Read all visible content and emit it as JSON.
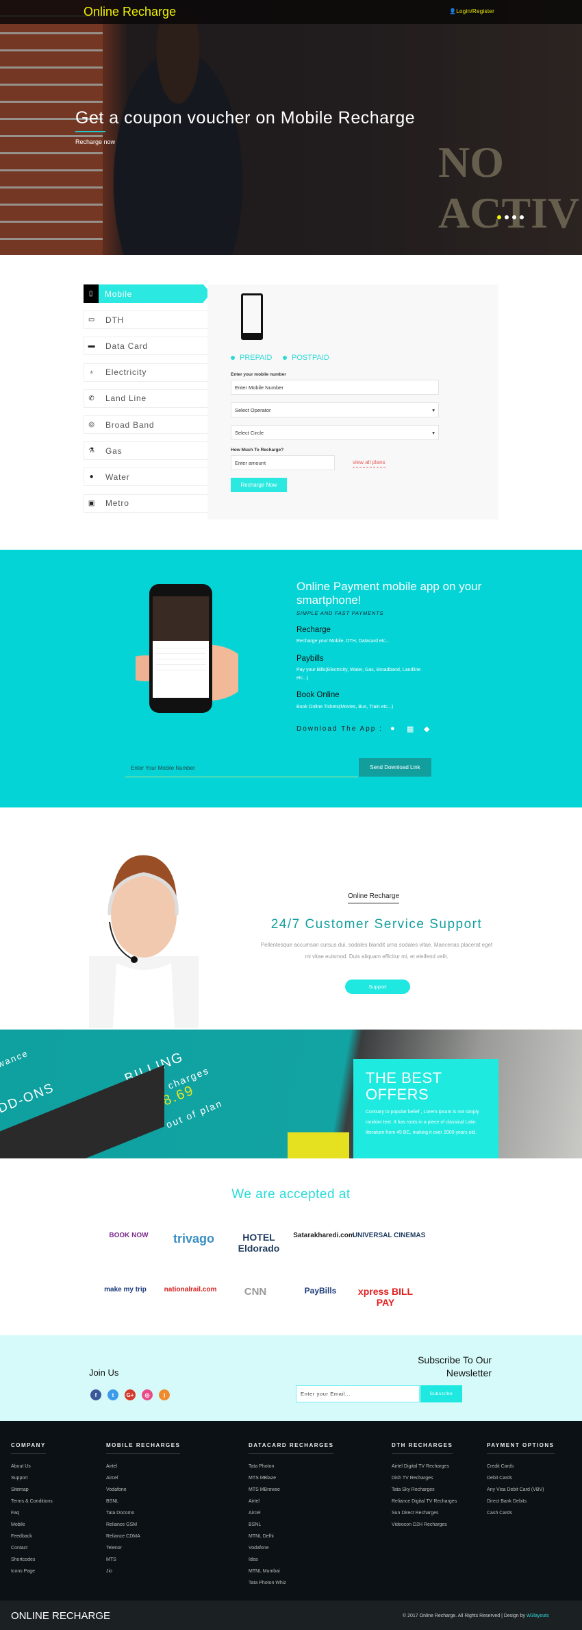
{
  "header": {
    "logo": "Online Recharge",
    "login": "Login/Register"
  },
  "hero": {
    "title": "Get a coupon voucher on Mobile Recharge",
    "subtitle": "Recharge now",
    "background_sign": "NO ACTIV",
    "slides": 4,
    "active_slide": 1
  },
  "recharge": {
    "tabs": [
      {
        "label": "Mobile",
        "icon": "mobile-icon",
        "active": true
      },
      {
        "label": "DTH",
        "icon": "tv-icon"
      },
      {
        "label": "Data Card",
        "icon": "credit-card-icon"
      },
      {
        "label": "Electricity",
        "icon": "bulb-icon"
      },
      {
        "label": "Land Line",
        "icon": "phone-icon"
      },
      {
        "label": "Broad Band",
        "icon": "globe-icon"
      },
      {
        "label": "Gas",
        "icon": "flask-icon"
      },
      {
        "label": "Water",
        "icon": "drop-icon"
      },
      {
        "label": "Metro",
        "icon": "train-icon"
      }
    ],
    "plan_types": [
      "PREPAID",
      "POSTPAID"
    ],
    "mobile_label": "Enter your mobile number",
    "mobile_placeholder": "Enter Mobile Number",
    "operator": "Select Operator",
    "circle": "Select Circle",
    "amount_label": "How Much To Recharge?",
    "amount_placeholder": "Enter amount",
    "view_plans": "view all plans",
    "submit": "Recharge Now"
  },
  "app": {
    "title": "Online Payment mobile app on your smartphone!",
    "tagline": "SIMPLE AND FAST PAYMENTS",
    "features": [
      {
        "title": "Recharge",
        "desc": "Recharge your Mobile, DTH, Datacard etc..."
      },
      {
        "title": "Paybills",
        "desc": "Pay your Bills(Electricity, Water, Gas, Broadband, Landline etc...)"
      },
      {
        "title": "Book Online",
        "desc": "Book Online Tickets(Movies, Bus, Train etc...)"
      }
    ],
    "download_label": "Download The App :",
    "platforms": [
      "apple-icon",
      "windows-icon",
      "android-icon"
    ],
    "input_placeholder": "Enter Your Mobile Number",
    "send_button": "Send Download Link"
  },
  "support": {
    "brand": "Online Recharge",
    "title": "24/7 Customer Service Support",
    "text": "Pellentesque accumsan cursus dui, sodales blandit urna sodales vitae. Maecenas placerat eget mi vitae euismod. Duis aliquam efficitur mi, et eleifend velit.",
    "button": "Support"
  },
  "offers": {
    "title": "THE BEST OFFERS",
    "text": "Contrary to popular belief , Lorem Ipsum is not simply random text. It has roots in a piece of classical Latin literature from 45 BC, making it over 2000 years old.",
    "image_text": [
      "BILLING",
      "New charges",
      "£8.69",
      "out of plan",
      "DD-ONS",
      "wance"
    ]
  },
  "accepted": {
    "title": "We are accepted at",
    "logos": [
      "BOOK NOW",
      "trivago",
      "HOTEL Eldorado",
      "Satarakharedi.com",
      "UNIVERSAL CINEMAS",
      "make my trip",
      "nationalrail.com",
      "CNN",
      "PayBills",
      "xpress BILL PAY"
    ]
  },
  "newsletter": {
    "join": "Join Us",
    "social": [
      "facebook-icon",
      "twitter-icon",
      "google-plus-icon",
      "dribbble-icon",
      "rss-icon"
    ],
    "title": "Subscribe To Our Newsletter",
    "placeholder": "Enter your Email...",
    "button": "Subscribe"
  },
  "footer": {
    "columns": [
      {
        "title": "COMPANY",
        "links": [
          "About Us",
          "Support",
          "Sitemap",
          "Terms & Conditions",
          "Faq",
          "Mobile",
          "Feedback",
          "Contact",
          "Shortcodes",
          "Icons Page"
        ]
      },
      {
        "title": "MOBILE RECHARGES",
        "links": [
          "Airtel",
          "Aircel",
          "Vodafone",
          "BSNL",
          "Tata Docomo",
          "Reliance GSM",
          "Reliance CDMA",
          "Telenor",
          "MTS",
          "Jio"
        ]
      },
      {
        "title": "DATACARD RECHARGES",
        "links": [
          "Tata Photon",
          "MTS MBlaze",
          "MTS MBrowse",
          "Airtel",
          "Aircel",
          "BSNL",
          "MTNL Delhi",
          "Vodafone",
          "Idea",
          "MTNL Mumbai",
          "Tata Photon Whiz"
        ]
      },
      {
        "title": "DTH RECHARGES",
        "links": [
          "Airtel Digital TV Recharges",
          "Dish TV Recharges",
          "Tata Sky Recharges",
          "Reliance Digital TV Recharges",
          "Sun Direct Recharges",
          "Videocon D2H Recharges"
        ]
      },
      {
        "title": "PAYMENT OPTIONS",
        "links": [
          "Credit Cards",
          "Debit Cards",
          "Any Visa Debit Card (VBV)",
          "Direct Bank Debits",
          "Cash Cards"
        ]
      }
    ],
    "brand": "ONLINE RECHARGE",
    "copyright": "© 2017 Online Recharge. All Rights Reserved | Design by ",
    "designer": "W3layouts"
  },
  "colors": {
    "accent": "#2be8e0",
    "teal": "#05d4d6",
    "dark_teal": "#139e9e",
    "logo_yellow": "#f2f200",
    "footer": "#0b1114"
  }
}
